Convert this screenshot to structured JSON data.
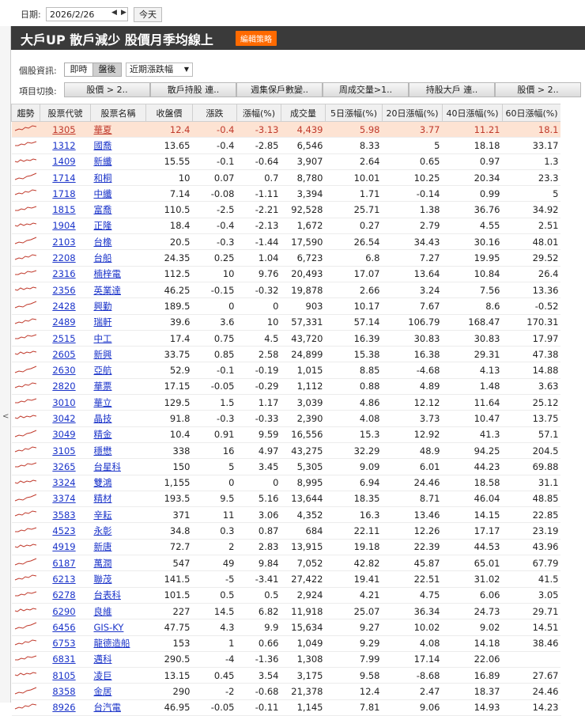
{
  "toolbar": {
    "date_label": "日期:",
    "date_value": "2026/2/26",
    "prev_icon": "triangle-left",
    "next_icon": "triangle-right",
    "today_label": "今天"
  },
  "header": {
    "title": "大戶UP 散戶減少 股價月季均線上",
    "edit_label": "編輯策略"
  },
  "info": {
    "label": "個股資訊:",
    "mode_realtime": "即時",
    "mode_after": "盤後",
    "dropdown_value": "近期漲跌幅"
  },
  "switch": {
    "label": "項目切換:",
    "buttons": [
      "股價 > 2..",
      "散戶持股 連..",
      "週集保戶數變..",
      "周成交量>1..",
      "持股大戶 連..",
      "股價 > 2.."
    ]
  },
  "table": {
    "headers": [
      "趨勢",
      "股票代號",
      "股票名稱",
      "收盤價",
      "漲跌",
      "漲幅(%)",
      "成交量",
      "5日漲幅(%)",
      "20日漲幅(%)",
      "40日漲幅(%)",
      "60日漲幅(%)"
    ],
    "rows": [
      {
        "code": "1305",
        "name": "華夏",
        "close": "12.4",
        "chg": "-0.4",
        "pct": "-3.13",
        "vol": "4,439",
        "d5": "5.98",
        "d20": "3.77",
        "d40": "11.21",
        "d60": "18.1"
      },
      {
        "code": "1312",
        "name": "國喬",
        "close": "13.65",
        "chg": "-0.4",
        "pct": "-2.85",
        "vol": "6,546",
        "d5": "8.33",
        "d20": "5",
        "d40": "18.18",
        "d60": "33.17"
      },
      {
        "code": "1409",
        "name": "新纖",
        "close": "15.55",
        "chg": "-0.1",
        "pct": "-0.64",
        "vol": "3,907",
        "d5": "2.64",
        "d20": "0.65",
        "d40": "0.97",
        "d60": "1.3"
      },
      {
        "code": "1714",
        "name": "和桐",
        "close": "10",
        "chg": "0.07",
        "pct": "0.7",
        "vol": "8,780",
        "d5": "10.01",
        "d20": "10.25",
        "d40": "20.34",
        "d60": "23.3"
      },
      {
        "code": "1718",
        "name": "中纖",
        "close": "7.14",
        "chg": "-0.08",
        "pct": "-1.11",
        "vol": "3,394",
        "d5": "1.71",
        "d20": "-0.14",
        "d40": "0.99",
        "d60": "5"
      },
      {
        "code": "1815",
        "name": "富喬",
        "close": "110.5",
        "chg": "-2.5",
        "pct": "-2.21",
        "vol": "92,528",
        "d5": "25.71",
        "d20": "1.38",
        "d40": "36.76",
        "d60": "34.92"
      },
      {
        "code": "1904",
        "name": "正隆",
        "close": "18.4",
        "chg": "-0.4",
        "pct": "-2.13",
        "vol": "1,672",
        "d5": "0.27",
        "d20": "2.79",
        "d40": "4.55",
        "d60": "2.51"
      },
      {
        "code": "2103",
        "name": "台橡",
        "close": "20.5",
        "chg": "-0.3",
        "pct": "-1.44",
        "vol": "17,590",
        "d5": "26.54",
        "d20": "34.43",
        "d40": "30.16",
        "d60": "48.01"
      },
      {
        "code": "2208",
        "name": "台船",
        "close": "24.35",
        "chg": "0.25",
        "pct": "1.04",
        "vol": "6,723",
        "d5": "6.8",
        "d20": "7.27",
        "d40": "19.95",
        "d60": "29.52"
      },
      {
        "code": "2316",
        "name": "楠梓電",
        "close": "112.5",
        "chg": "10",
        "pct": "9.76",
        "vol": "20,493",
        "d5": "17.07",
        "d20": "13.64",
        "d40": "10.84",
        "d60": "26.4"
      },
      {
        "code": "2356",
        "name": "英業達",
        "close": "46.25",
        "chg": "-0.15",
        "pct": "-0.32",
        "vol": "19,878",
        "d5": "2.66",
        "d20": "3.24",
        "d40": "7.56",
        "d60": "13.36"
      },
      {
        "code": "2428",
        "name": "興勤",
        "close": "189.5",
        "chg": "0",
        "pct": "0",
        "vol": "903",
        "d5": "10.17",
        "d20": "7.67",
        "d40": "8.6",
        "d60": "-0.52"
      },
      {
        "code": "2489",
        "name": "瑞軒",
        "close": "39.6",
        "chg": "3.6",
        "pct": "10",
        "vol": "57,331",
        "d5": "57.14",
        "d20": "106.79",
        "d40": "168.47",
        "d60": "170.31"
      },
      {
        "code": "2515",
        "name": "中工",
        "close": "17.4",
        "chg": "0.75",
        "pct": "4.5",
        "vol": "43,720",
        "d5": "16.39",
        "d20": "30.83",
        "d40": "30.83",
        "d60": "17.97"
      },
      {
        "code": "2605",
        "name": "新興",
        "close": "33.75",
        "chg": "0.85",
        "pct": "2.58",
        "vol": "24,899",
        "d5": "15.38",
        "d20": "16.38",
        "d40": "29.31",
        "d60": "47.38"
      },
      {
        "code": "2630",
        "name": "亞航",
        "close": "52.9",
        "chg": "-0.1",
        "pct": "-0.19",
        "vol": "1,015",
        "d5": "8.85",
        "d20": "-4.68",
        "d40": "4.13",
        "d60": "14.88"
      },
      {
        "code": "2820",
        "name": "華票",
        "close": "17.15",
        "chg": "-0.05",
        "pct": "-0.29",
        "vol": "1,112",
        "d5": "0.88",
        "d20": "4.89",
        "d40": "1.48",
        "d60": "3.63"
      },
      {
        "code": "3010",
        "name": "華立",
        "close": "129.5",
        "chg": "1.5",
        "pct": "1.17",
        "vol": "3,039",
        "d5": "4.86",
        "d20": "12.12",
        "d40": "11.64",
        "d60": "25.12"
      },
      {
        "code": "3042",
        "name": "晶技",
        "close": "91.8",
        "chg": "-0.3",
        "pct": "-0.33",
        "vol": "2,390",
        "d5": "4.08",
        "d20": "3.73",
        "d40": "10.47",
        "d60": "13.75"
      },
      {
        "code": "3049",
        "name": "精金",
        "close": "10.4",
        "chg": "0.91",
        "pct": "9.59",
        "vol": "16,556",
        "d5": "15.3",
        "d20": "12.92",
        "d40": "41.3",
        "d60": "57.1"
      },
      {
        "code": "3105",
        "name": "穩懋",
        "close": "338",
        "chg": "16",
        "pct": "4.97",
        "vol": "43,275",
        "d5": "32.29",
        "d20": "48.9",
        "d40": "94.25",
        "d60": "204.5"
      },
      {
        "code": "3265",
        "name": "台星科",
        "close": "150",
        "chg": "5",
        "pct": "3.45",
        "vol": "5,305",
        "d5": "9.09",
        "d20": "6.01",
        "d40": "44.23",
        "d60": "69.88"
      },
      {
        "code": "3324",
        "name": "雙鴻",
        "close": "1,155",
        "chg": "0",
        "pct": "0",
        "vol": "8,995",
        "d5": "6.94",
        "d20": "24.46",
        "d40": "18.58",
        "d60": "31.1"
      },
      {
        "code": "3374",
        "name": "精材",
        "close": "193.5",
        "chg": "9.5",
        "pct": "5.16",
        "vol": "13,644",
        "d5": "18.35",
        "d20": "8.71",
        "d40": "46.04",
        "d60": "48.85"
      },
      {
        "code": "3583",
        "name": "辛耘",
        "close": "371",
        "chg": "11",
        "pct": "3.06",
        "vol": "4,352",
        "d5": "16.3",
        "d20": "13.46",
        "d40": "14.15",
        "d60": "22.85"
      },
      {
        "code": "4523",
        "name": "永彰",
        "close": "34.8",
        "chg": "0.3",
        "pct": "0.87",
        "vol": "684",
        "d5": "22.11",
        "d20": "12.26",
        "d40": "17.17",
        "d60": "23.19"
      },
      {
        "code": "4919",
        "name": "新唐",
        "close": "72.7",
        "chg": "2",
        "pct": "2.83",
        "vol": "13,915",
        "d5": "19.18",
        "d20": "22.39",
        "d40": "44.53",
        "d60": "43.96"
      },
      {
        "code": "6187",
        "name": "萬潤",
        "close": "547",
        "chg": "49",
        "pct": "9.84",
        "vol": "7,052",
        "d5": "42.82",
        "d20": "45.87",
        "d40": "65.01",
        "d60": "67.79"
      },
      {
        "code": "6213",
        "name": "聯茂",
        "close": "141.5",
        "chg": "-5",
        "pct": "-3.41",
        "vol": "27,422",
        "d5": "19.41",
        "d20": "22.51",
        "d40": "31.02",
        "d60": "41.5"
      },
      {
        "code": "6278",
        "name": "台表科",
        "close": "101.5",
        "chg": "0.5",
        "pct": "0.5",
        "vol": "2,924",
        "d5": "4.21",
        "d20": "4.75",
        "d40": "6.06",
        "d60": "3.05"
      },
      {
        "code": "6290",
        "name": "良維",
        "close": "227",
        "chg": "14.5",
        "pct": "6.82",
        "vol": "11,918",
        "d5": "25.07",
        "d20": "36.34",
        "d40": "24.73",
        "d60": "29.71"
      },
      {
        "code": "6456",
        "name": "GIS-KY",
        "close": "47.75",
        "chg": "4.3",
        "pct": "9.9",
        "vol": "15,634",
        "d5": "9.27",
        "d20": "10.02",
        "d40": "9.02",
        "d60": "14.51"
      },
      {
        "code": "6753",
        "name": "龍德造船",
        "close": "153",
        "chg": "1",
        "pct": "0.66",
        "vol": "1,049",
        "d5": "9.29",
        "d20": "4.08",
        "d40": "14.18",
        "d60": "38.46"
      },
      {
        "code": "6831",
        "name": "邁科",
        "close": "290.5",
        "chg": "-4",
        "pct": "-1.36",
        "vol": "1,308",
        "d5": "7.99",
        "d20": "17.14",
        "d40": "22.06",
        "d60": ""
      },
      {
        "code": "8105",
        "name": "凌巨",
        "close": "13.15",
        "chg": "0.45",
        "pct": "3.54",
        "vol": "3,175",
        "d5": "9.58",
        "d20": "-8.68",
        "d40": "16.89",
        "d60": "27.67"
      },
      {
        "code": "8358",
        "name": "金居",
        "close": "290",
        "chg": "-2",
        "pct": "-0.68",
        "vol": "21,378",
        "d5": "12.4",
        "d20": "2.47",
        "d40": "18.37",
        "d60": "24.46"
      },
      {
        "code": "8926",
        "name": "台汽電",
        "close": "46.95",
        "chg": "-0.05",
        "pct": "-0.11",
        "vol": "1,145",
        "d5": "7.81",
        "d20": "9.06",
        "d40": "14.93",
        "d60": "14.23"
      }
    ]
  },
  "colors": {
    "accent": "#ff6a00",
    "title_bg": "#3a3a3a",
    "highlight_row": "#fde3d3",
    "link": "#1a33c9",
    "trend_line": "#c0392b"
  }
}
